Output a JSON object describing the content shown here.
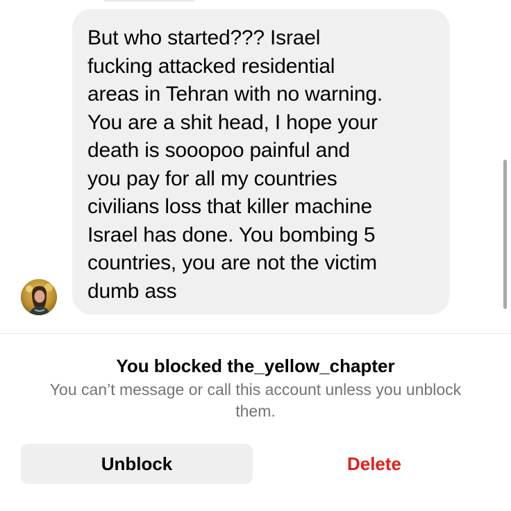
{
  "message": {
    "text": "But who started??? Israel\nfucking attacked residential\nareas in Tehran with no warning.\nYou are a shit head, I hope your\ndeath is sooopoo painful and\nyou pay for all my countries\ncivilians loss that killer machine\nIsrael has done. You bombing 5\ncountries, you are not the victim\ndumb ass"
  },
  "blocked_notice": {
    "title": "You blocked the_yellow_chapter",
    "subtitle": "You can’t message or call this account unless you unblock them."
  },
  "actions": {
    "unblock_label": "Unblock",
    "delete_label": "Delete"
  },
  "colors": {
    "bubble_background": "#f0f0f0",
    "subtitle_text": "#737373",
    "unblock_button_background": "#efefef",
    "delete_text": "#e0201b"
  }
}
